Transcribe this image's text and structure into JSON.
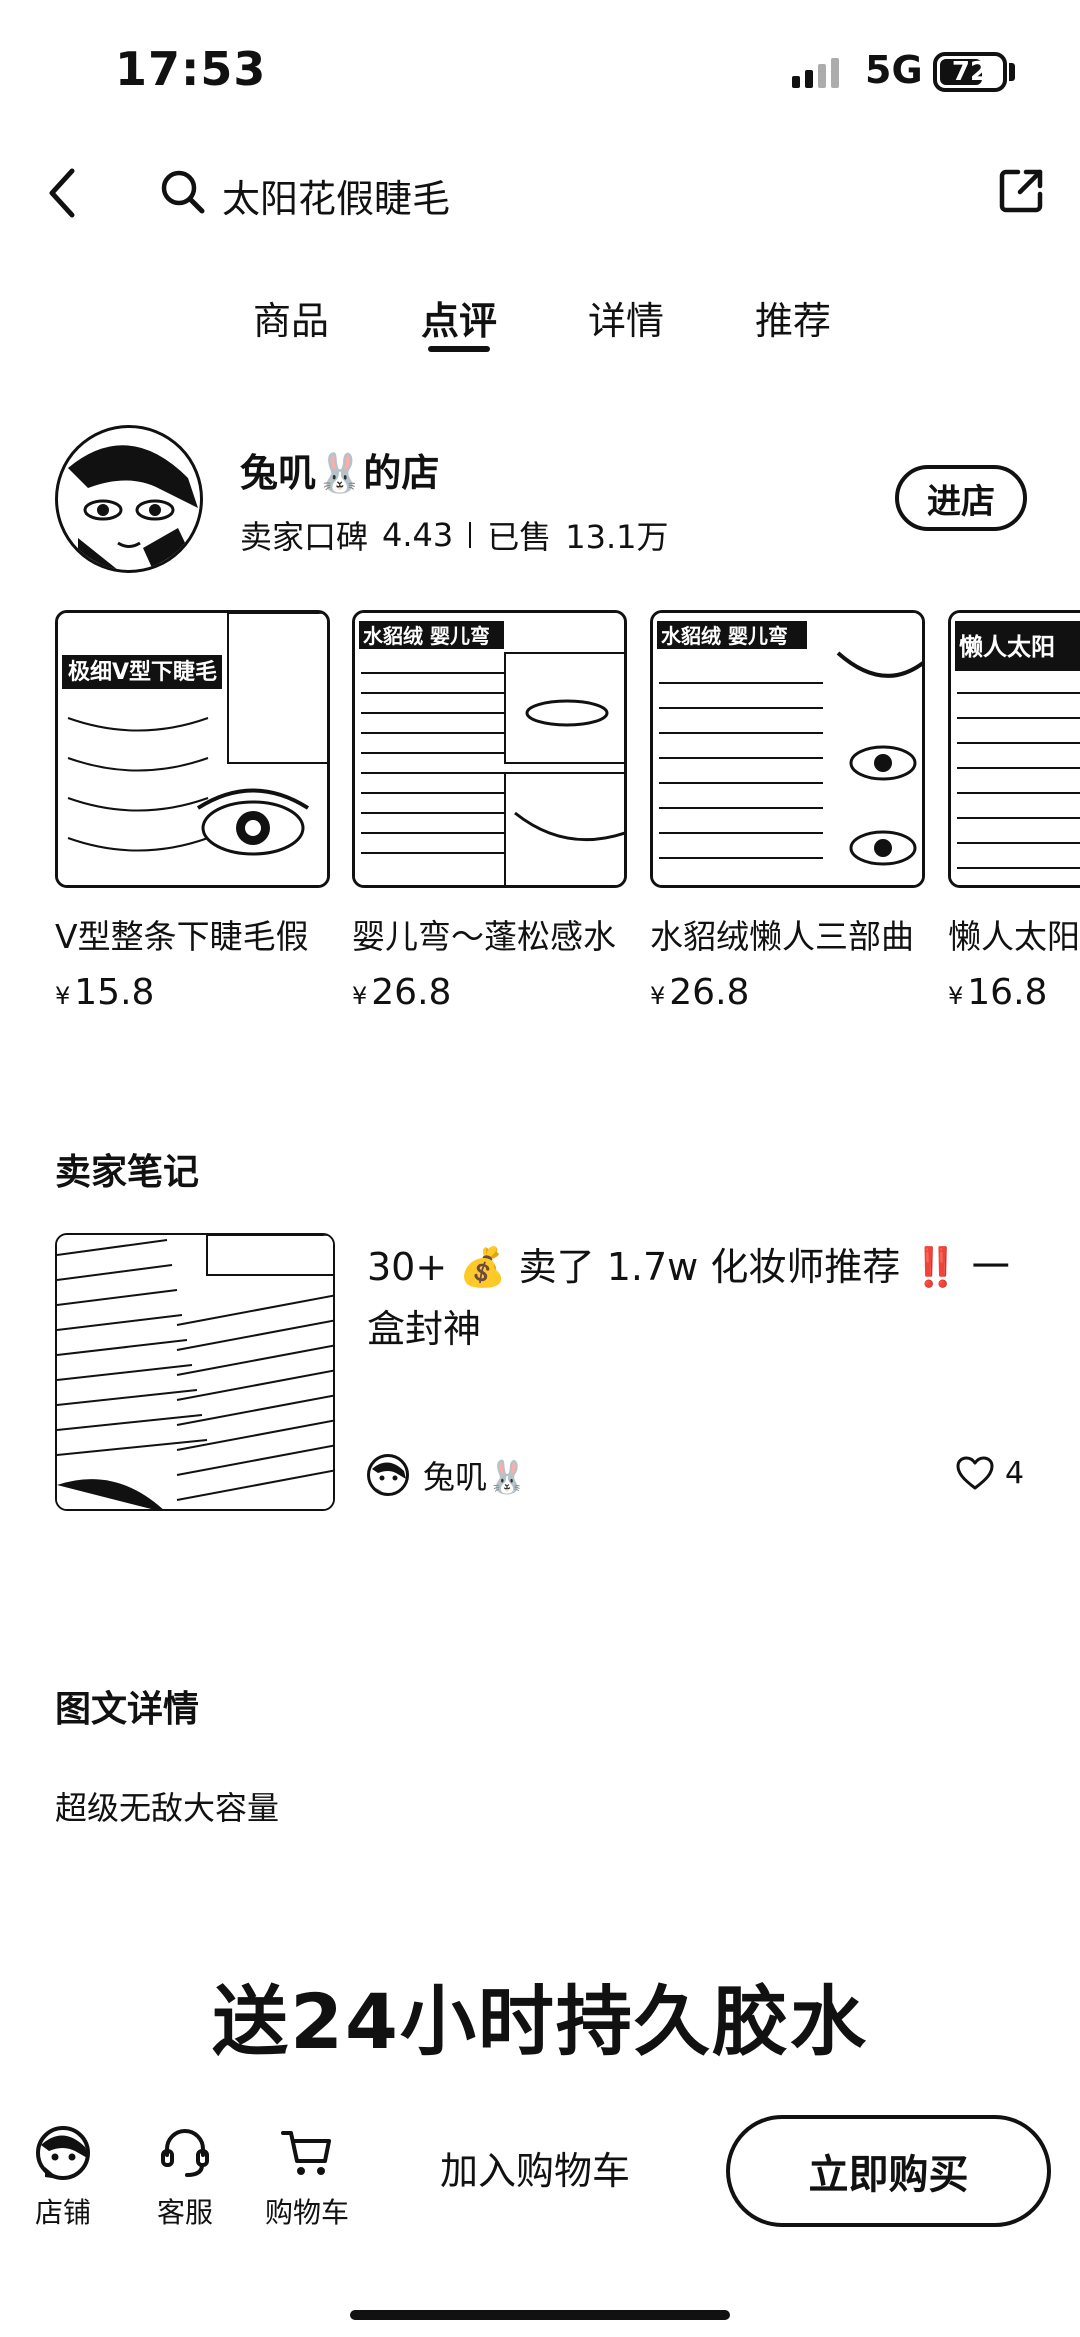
{
  "status": {
    "time": "17:53",
    "network": "5G",
    "battery": "72",
    "battery_level": 0.72
  },
  "header": {
    "search_text": "太阳花假睫毛"
  },
  "tabs": [
    {
      "label": "商品",
      "active": false
    },
    {
      "label": "点评",
      "active": true
    },
    {
      "label": "详情",
      "active": false
    },
    {
      "label": "推荐",
      "active": false
    }
  ],
  "shop": {
    "name": "兔叽🐰的店",
    "rating_label": "卖家口碑",
    "rating": "4.43",
    "sold_label": "已售",
    "sold": "13.1万",
    "enter_label": "进店"
  },
  "products": [
    {
      "title": "V型整条下睫毛假",
      "currency": "¥",
      "price": "15.8",
      "image_text": "极细V型下睫毛"
    },
    {
      "title": "婴儿弯～蓬松感水",
      "currency": "¥",
      "price": "26.8",
      "image_text": "水貂绒 婴儿弯"
    },
    {
      "title": "水貂绒懒人三部曲",
      "currency": "¥",
      "price": "26.8",
      "image_text": "水貂绒 婴儿弯"
    },
    {
      "title": "懒人太阳花",
      "currency": "¥",
      "price": "16.8",
      "image_text": "懒人太阳"
    }
  ],
  "seller_notes": {
    "section_title": "卖家笔记",
    "note_title": "30+ 💰 卖了 1.7w 化妆师推荐 ‼️ 一盒封神",
    "author": "兔叽🐰",
    "likes": "4"
  },
  "details": {
    "section_title": "图文详情",
    "description": "超级无敌大容量",
    "banner": "送24小时持久胶水"
  },
  "bottom_bar": {
    "shop_label": "店铺",
    "service_label": "客服",
    "cart_label": "购物车",
    "add_cart_label": "加入购物车",
    "buy_label": "立即购买"
  }
}
